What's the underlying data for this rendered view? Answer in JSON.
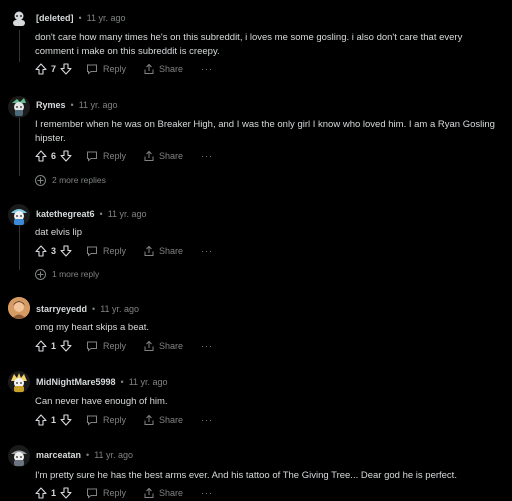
{
  "actions": {
    "reply": "Reply",
    "share": "Share",
    "more": "···"
  },
  "comments": [
    {
      "username": "[deleted]",
      "time": "11 yr. ago",
      "avatar": "deleted-user-avatar",
      "text": "don't care how many times he's on this subreddit, i loves me some gosling. i also don't care that every comment i make on this subreddit is creepy.",
      "votes": "7"
    },
    {
      "username": "Rymes",
      "time": "11 yr. ago",
      "avatar": "snoo-avatar-green",
      "text": "I remember when he was on Breaker High, and I was the only girl I know who loved him. I am a Ryan Gosling hipster.",
      "votes": "6",
      "more_replies": "2 more replies"
    },
    {
      "username": "katethegreat6",
      "time": "11 yr. ago",
      "avatar": "snoo-avatar-blue",
      "text": "dat elvis lip",
      "votes": "3",
      "more_replies": "1 more reply"
    },
    {
      "username": "starryeyedd",
      "time": "11 yr. ago",
      "avatar": "photo-avatar",
      "text": "omg my heart skips a beat.",
      "votes": "1"
    },
    {
      "username": "MidNightMare5998",
      "time": "11 yr. ago",
      "avatar": "snoo-avatar-yellow",
      "text": "Can never have enough of him.",
      "votes": "1"
    },
    {
      "username": "marceatan",
      "time": "11 yr. ago",
      "avatar": "snoo-avatar-gray",
      "text": "I'm pretty sure he has the best arms ever. And his tattoo of The Giving Tree... Dear god he is perfect.",
      "votes": "1"
    }
  ]
}
